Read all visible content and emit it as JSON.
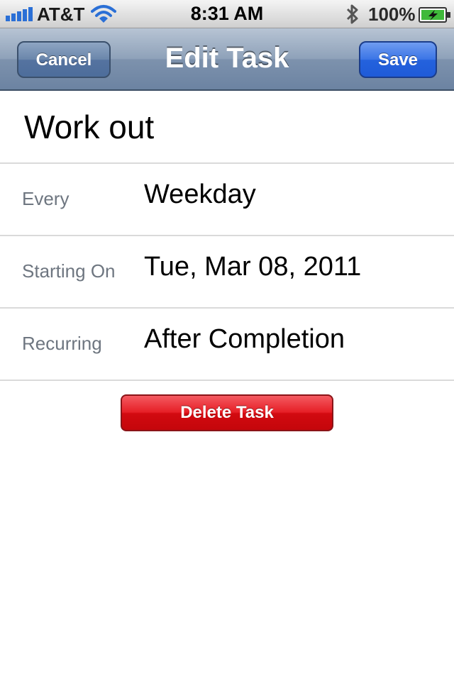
{
  "status_bar": {
    "carrier": "AT&T",
    "time": "8:31 AM",
    "battery": "100%",
    "icons": [
      "signal-bars-icon",
      "wifi-icon",
      "bluetooth-icon",
      "battery-charging-icon"
    ]
  },
  "nav": {
    "title": "Edit Task",
    "cancel_label": "Cancel",
    "save_label": "Save"
  },
  "task": {
    "name": "Work out",
    "fields": [
      {
        "label": "Every",
        "value": "Weekday"
      },
      {
        "label": "Starting On",
        "value": "Tue, Mar 08, 2011"
      },
      {
        "label": "Recurring",
        "value": "After Completion"
      }
    ]
  },
  "actions": {
    "delete_label": "Delete Task"
  },
  "colors": {
    "nav_bar": "#8ea1b9",
    "save_button": "#2462dd",
    "delete_button": "#e61f26",
    "label_text": "#6e7680"
  }
}
